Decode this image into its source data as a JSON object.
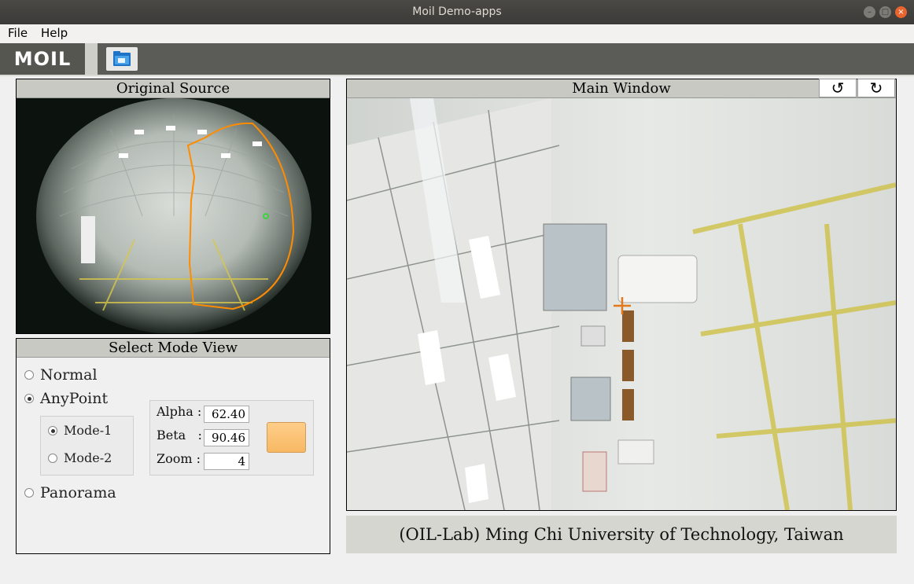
{
  "window": {
    "title": "Moil Demo-apps"
  },
  "menu": {
    "file": "File",
    "help": "Help"
  },
  "toolbar": {
    "logo": "MOIL"
  },
  "original": {
    "title": "Original Source"
  },
  "mode": {
    "title": "Select Mode View",
    "normal": "Normal",
    "anypoint": "AnyPoint",
    "mode1": "Mode-1",
    "mode2": "Mode-2",
    "panorama": "Panorama",
    "selected": "AnyPoint",
    "submode": "Mode-1"
  },
  "params": {
    "alpha_label": "Alpha :",
    "beta_label": "Beta   :",
    "zoom_label": "Zoom :",
    "alpha": "62.40",
    "beta": "90.46",
    "zoom": "4"
  },
  "main": {
    "title": "Main Window"
  },
  "footer": {
    "text": "(OIL-Lab) Ming Chi University of Technology, Taiwan"
  },
  "icons": [
    "minimize-icon",
    "maximize-icon",
    "close-icon",
    "folder-icon",
    "rotate-left-icon",
    "rotate-right-icon"
  ],
  "colors": {
    "accent": "#f7b863",
    "selection": "#ff8c00",
    "toolbar": "#5b5c57"
  }
}
